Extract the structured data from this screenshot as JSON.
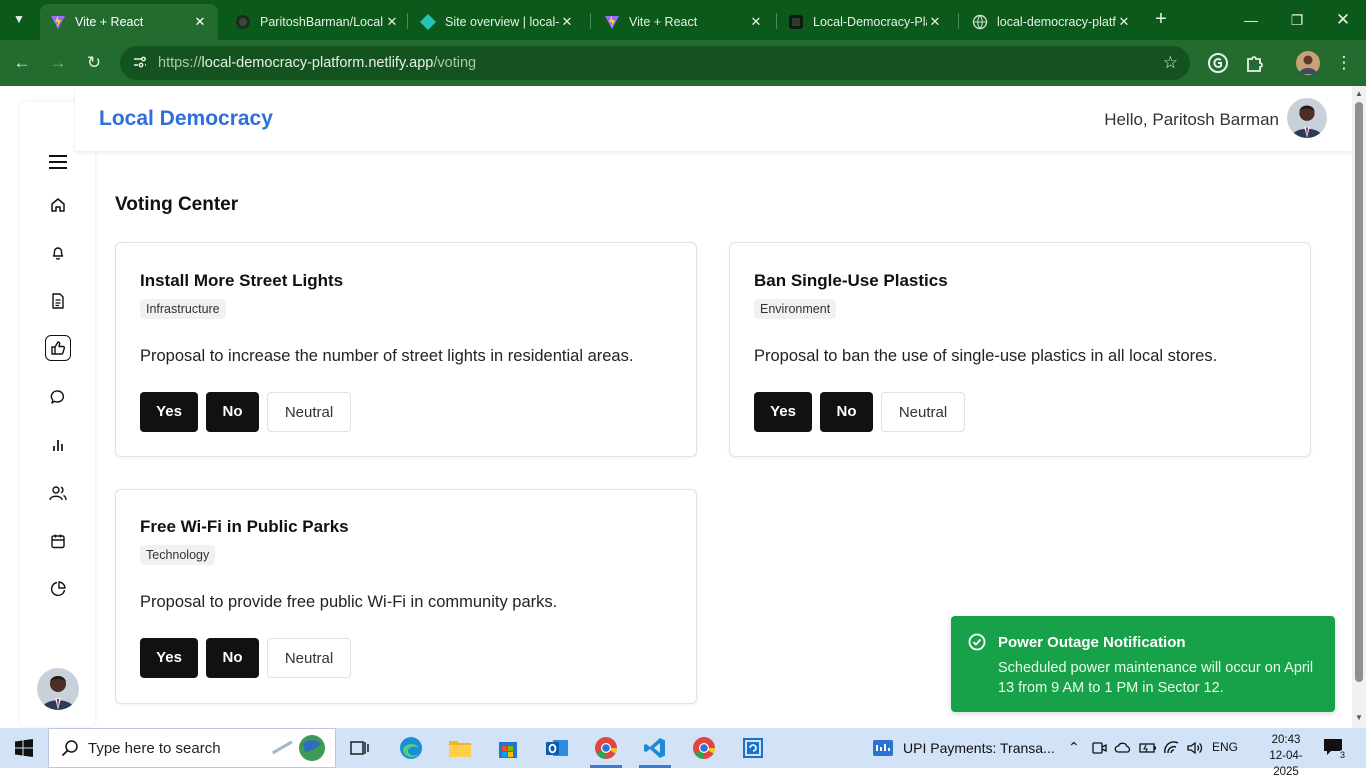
{
  "browser": {
    "tabs": [
      {
        "title": "Vite + React",
        "active": true
      },
      {
        "title": "ParitoshBarman/Local",
        "active": false
      },
      {
        "title": "Site overview | local-c",
        "active": false
      },
      {
        "title": "Vite + React",
        "active": false
      },
      {
        "title": "Local-Democracy-Pla",
        "active": false
      },
      {
        "title": "local-democracy-platf",
        "active": false
      }
    ],
    "close_glyph": "✕",
    "url_scheme": "https://",
    "url_host": "local-democracy-platform.netlify.app",
    "url_path": "/voting"
  },
  "header": {
    "brand": "Local Democracy",
    "greeting": "Hello, Paritosh Barman"
  },
  "main": {
    "title": "Voting Center",
    "proposals": [
      {
        "title": "Install More Street Lights",
        "category": "Infrastructure",
        "description": "Proposal to increase the number of street lights in residential areas.",
        "yes": "Yes",
        "no": "No",
        "neutral": "Neutral"
      },
      {
        "title": "Ban Single-Use Plastics",
        "category": "Environment",
        "description": "Proposal to ban the use of single-use plastics in all local stores.",
        "yes": "Yes",
        "no": "No",
        "neutral": "Neutral"
      },
      {
        "title": "Free Wi-Fi in Public Parks",
        "category": "Technology",
        "description": "Proposal to provide free public Wi-Fi in community parks.",
        "yes": "Yes",
        "no": "No",
        "neutral": "Neutral"
      }
    ]
  },
  "sidebar": {
    "icons": [
      "menu-icon",
      "home-icon",
      "bell-icon",
      "document-icon",
      "thumbs-up-icon",
      "chat-icon",
      "bar-chart-icon",
      "users-icon",
      "calendar-icon",
      "pie-chart-icon"
    ],
    "active": "thumbs-up-icon"
  },
  "toast": {
    "title": "Power Outage Notification",
    "message": "Scheduled power maintenance will occur on April 13 from 9 AM to 1 PM in Sector 12."
  },
  "taskbar": {
    "search_placeholder": "Type here to search",
    "app_label": "UPI Payments: Transa...",
    "language": "ENG",
    "time": "20:43",
    "date": "12-04-2025",
    "notification_count": "3"
  },
  "colors": {
    "brand": "#2f6fdc",
    "chrome": "#236b2e",
    "toast": "#17a24a"
  }
}
